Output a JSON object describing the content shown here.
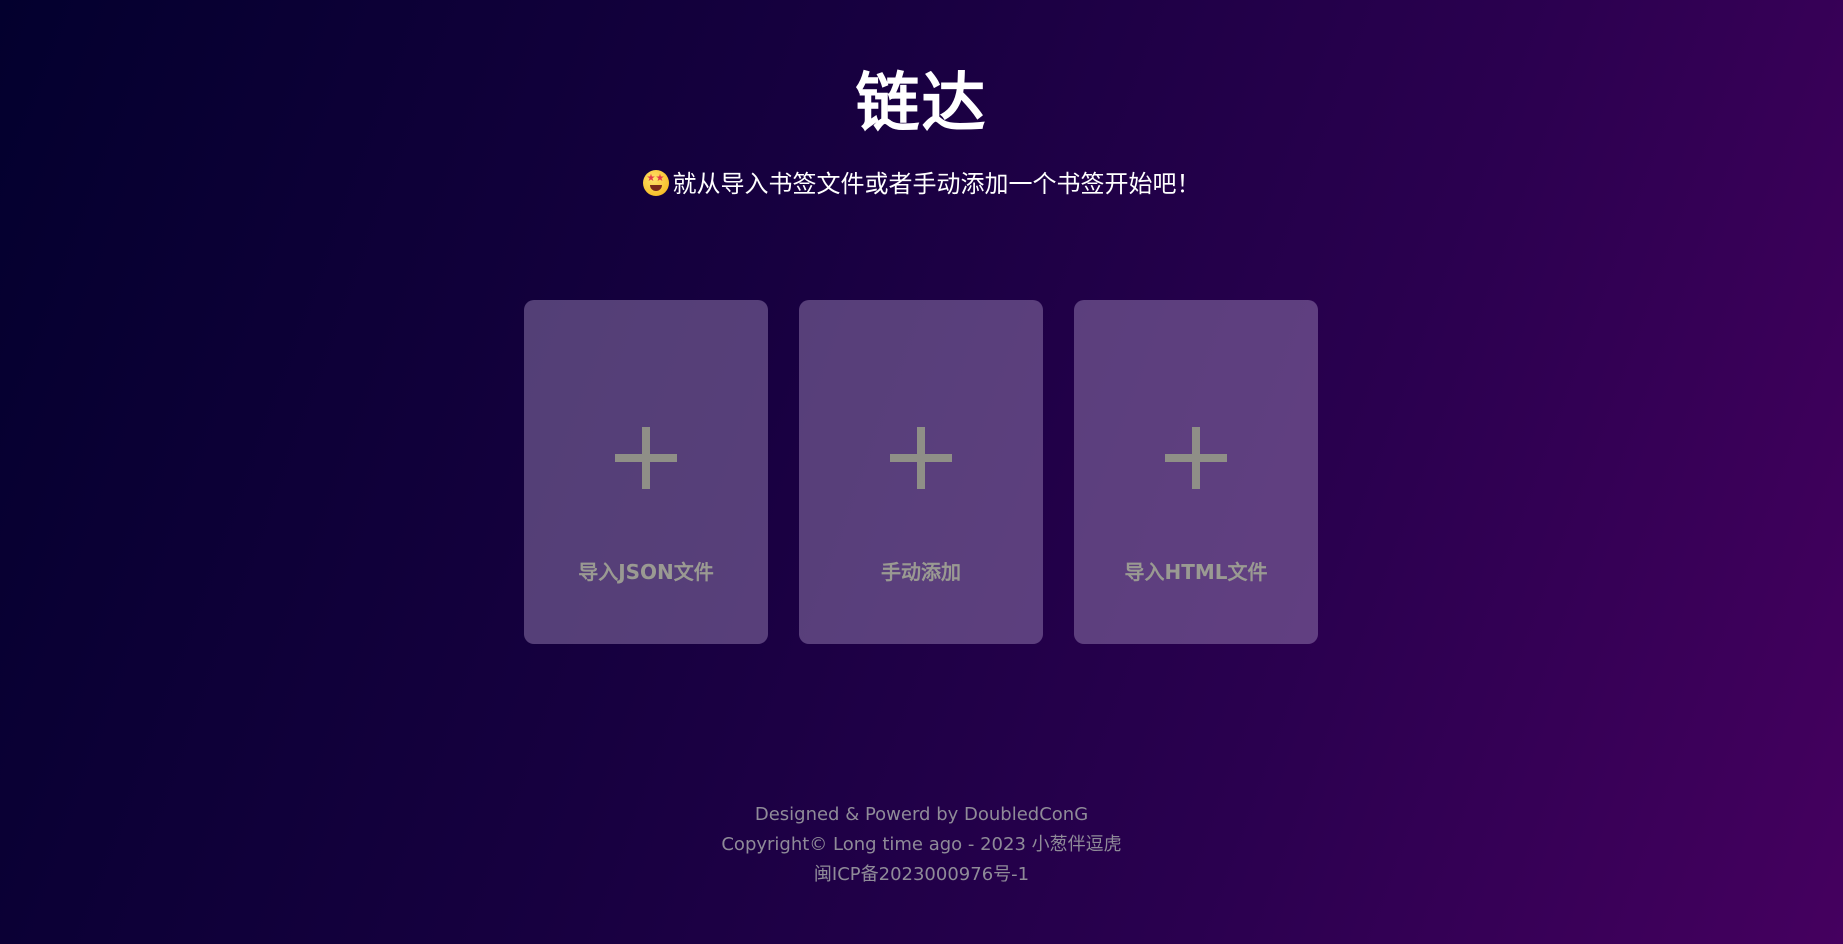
{
  "header": {
    "title": "链达",
    "subtitle": "就从导入书签文件或者手动添加一个书签开始吧！",
    "subtitle_icon": "star-struck-emoji"
  },
  "cards": [
    {
      "label": "导入JSON文件",
      "icon": "plus-icon"
    },
    {
      "label": "手动添加",
      "icon": "plus-icon"
    },
    {
      "label": "导入HTML文件",
      "icon": "plus-icon"
    }
  ],
  "footer": {
    "designed": "Designed & Powerd by DoubledConG",
    "copyright": "Copyright© Long time ago - 2023 小葱伴逗虎",
    "icp": "闽ICP备2023000976号-1"
  },
  "colors": {
    "background_start": "#03002e",
    "background_end": "#45005f",
    "card": "#8a6fa0",
    "plus": "#8f8f87",
    "footer_text": "#8f8b98"
  }
}
